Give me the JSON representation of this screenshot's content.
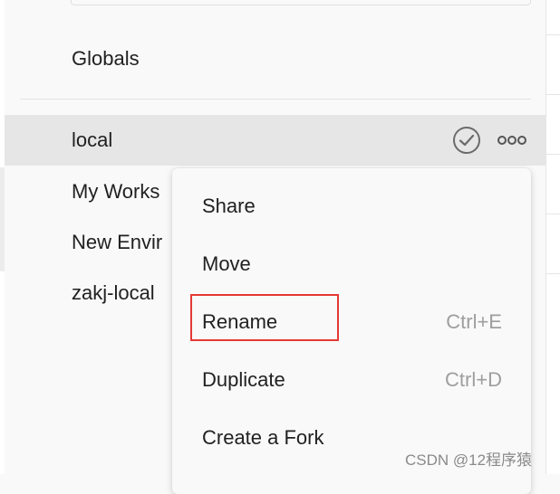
{
  "sidebar": {
    "globals_label": "Globals",
    "environments": [
      {
        "label": "local",
        "active": true
      },
      {
        "label": "My Works"
      },
      {
        "label": "New Envir"
      },
      {
        "label": "zakj-local"
      }
    ],
    "active_icons": [
      "check-circle-icon",
      "more-horizontal-icon"
    ]
  },
  "context_menu": {
    "items": [
      {
        "label": "Share",
        "shortcut": ""
      },
      {
        "label": "Move",
        "shortcut": ""
      },
      {
        "label": "Rename",
        "shortcut": "Ctrl+E",
        "highlighted": true
      },
      {
        "label": "Duplicate",
        "shortcut": "Ctrl+D"
      },
      {
        "label": "Create a Fork",
        "shortcut": ""
      }
    ]
  },
  "watermark": "CSDN @12程序猿",
  "colors": {
    "background": "#f9f9f9",
    "active_row": "#e6e6e6",
    "highlight_border": "#e53935",
    "shortcut_text": "#9e9e9e"
  }
}
